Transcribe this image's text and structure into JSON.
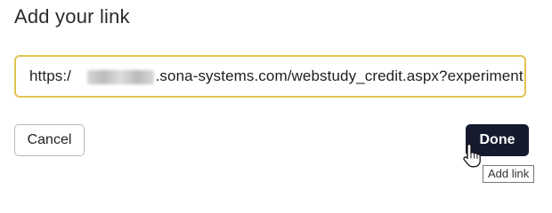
{
  "dialog": {
    "title": "Add your link",
    "url_input": {
      "value": "https:/           .sona-systems.com/webstudy_credit.aspx?experiment",
      "placeholder": ""
    },
    "cancel_label": "Cancel",
    "done_label": "Done",
    "tooltip": "Add link"
  },
  "colors": {
    "input_border_focus": "#e1c453",
    "primary_button": "#151a2e",
    "secondary_border": "#b9b9b9"
  },
  "icons": {
    "cursor": "hand-pointer-icon"
  }
}
